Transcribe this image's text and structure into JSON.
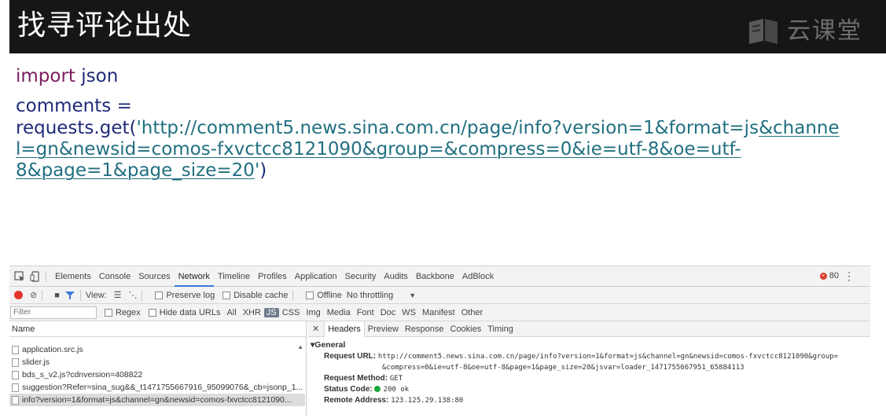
{
  "slide": {
    "title": "找寻评论出处",
    "brand": "云课堂",
    "brand_icon": "book-logo-icon"
  },
  "code": {
    "line1_keyword": "import",
    "line1_rest": " json",
    "line2": "comments =",
    "line3_pre": "requests.get(",
    "line3_str": "'http://comment5.news.sina.com.cn/page/info?version=1&format=js",
    "line3_link": "&channe",
    "line4_str": "l=gn&newsid=comos-fxvct",
    "line4_link": "cc8121090&group=&compress=0&ie=utf-8&oe=utf-",
    "line5_link": "8&page=1&page_size=20",
    "line5_end_str": "'",
    "line5_close": ")"
  },
  "devtools": {
    "tabs": [
      "Elements",
      "Console",
      "Sources",
      "Network",
      "Timeline",
      "Profiles",
      "Application",
      "Security",
      "Audits",
      "Backbone",
      "AdBlock"
    ],
    "active_tab": "Network",
    "error_count": "80",
    "toolbar": {
      "view_label": "View:",
      "preserve_log": "Preserve log",
      "disable_cache": "Disable cache",
      "offline": "Offline",
      "throttling": "No throttling"
    },
    "filter": {
      "placeholder": "Filter",
      "regex": "Regex",
      "hide_data_urls": "Hide data URLs",
      "types": [
        "All",
        "XHR",
        "JS",
        "CSS",
        "Img",
        "Media",
        "Font",
        "Doc",
        "WS",
        "Manifest",
        "Other"
      ],
      "selected_type": "JS"
    },
    "requests_header": "Name",
    "requests": [
      "application.src.js",
      "slider.js",
      "bds_s_v2.js?cdnversion=408822",
      "suggestion?Refer=sina_sug&&_t1471755667916_95099076&_cb=jsonp_1...",
      "info?version=1&format=js&channel=gn&newsid=comos-fxvctcc8121090..."
    ],
    "selected_request_index": 4,
    "detail_tabs": [
      "Headers",
      "Preview",
      "Response",
      "Cookies",
      "Timing"
    ],
    "active_detail_tab": "Headers",
    "general": {
      "title": "General",
      "request_url_label": "Request URL:",
      "request_url_1": "http://comment5.news.sina.com.cn/page/info?version=1&format=js&channel=gn&newsid=comos-fxvctcc8121090&group=",
      "request_url_2": "&compress=0&ie=utf-8&oe=utf-8&page=1&page_size=20&jsvar=loader_1471755667951_65884113",
      "method_label": "Request Method:",
      "method": "GET",
      "status_label": "Status Code:",
      "status": "200 ok",
      "remote_label": "Remote Address:",
      "remote": "123.125.29.138:80"
    }
  }
}
